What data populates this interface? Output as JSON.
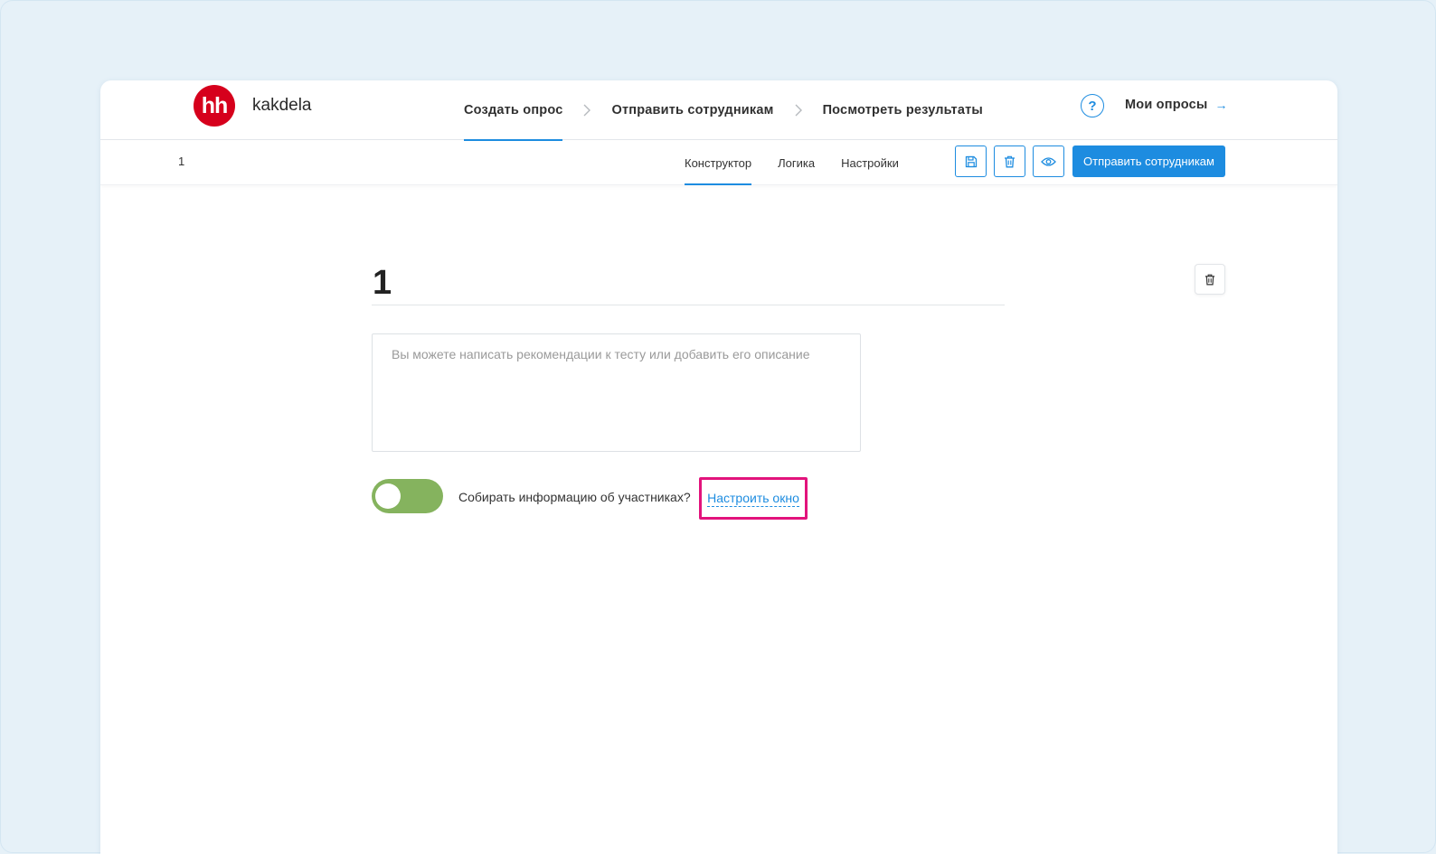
{
  "header": {
    "logo_text": "hh",
    "brand": "kakdela",
    "steps": [
      {
        "label": "Создать опрос",
        "active": true
      },
      {
        "label": "Отправить сотрудникам",
        "active": false
      },
      {
        "label": "Посмотреть результаты",
        "active": false
      }
    ],
    "help_label": "?",
    "my_polls_label": "Мои опросы",
    "my_polls_arrow": "→"
  },
  "toolbar": {
    "survey_number": "1",
    "tabs": [
      {
        "label": "Конструктор",
        "active": true
      },
      {
        "label": "Логика",
        "active": false
      },
      {
        "label": "Настройки",
        "active": false
      }
    ],
    "icons": [
      "save-icon",
      "trash-icon",
      "eye-icon"
    ],
    "send_label": "Отправить сотрудникам"
  },
  "content": {
    "title": "1",
    "description_placeholder": "Вы можете написать рекомендации к тесту или добавить его описание",
    "description_value": "",
    "collect_toggle_on": true,
    "collect_label": "Собирать информацию об участниках?",
    "configure_link": "Настроить окно"
  },
  "colors": {
    "accent": "#1d8ce0",
    "logo_red": "#d6001c",
    "toggle_green": "#85b35e",
    "highlight_pink": "#e2137c"
  }
}
